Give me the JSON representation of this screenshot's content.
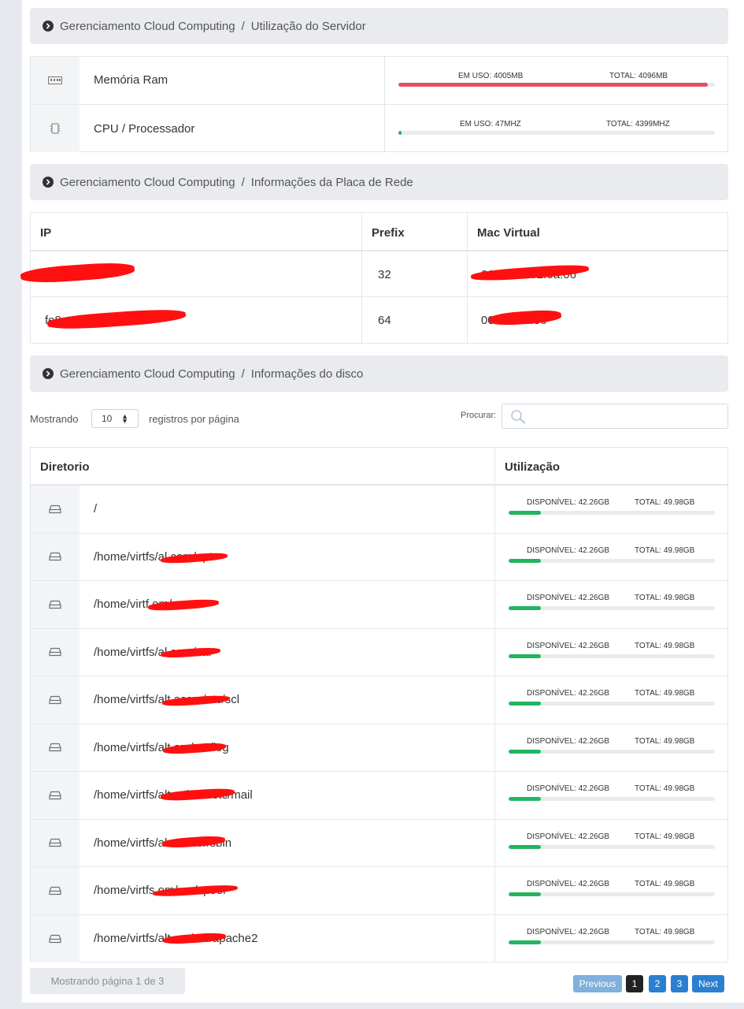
{
  "breadcrumbs": {
    "server": {
      "root": "Gerenciamento Cloud Computing",
      "separator": "/",
      "current": "Utilização do Servidor"
    },
    "network": {
      "root": "Gerenciamento Cloud Computing",
      "separator": "/",
      "current": "Informações da Placa de Rede"
    },
    "disk": {
      "root": "Gerenciamento Cloud Computing",
      "separator": "/",
      "current": "Informações do disco"
    }
  },
  "server_usage": [
    {
      "label": "Memória Ram",
      "icon": "ram-icon",
      "in_use": "EM USO: 4005MB",
      "total": "TOTAL: 4096MB",
      "fraction": 0.978,
      "color": "#e2525c"
    },
    {
      "label": "CPU / Processador",
      "icon": "cpu-icon",
      "in_use": "EM USO: 47MHZ",
      "total": "TOTAL: 4399MHZ",
      "fraction": 0.011,
      "color": "#22b55e"
    }
  ],
  "network": {
    "headers": {
      "ip": "IP",
      "prefix": "Prefix",
      "mac": "Mac Virtual"
    },
    "rows": [
      {
        "ip": "14",
        "prefix": "32",
        "mac": "00:50:56:02:0a:06"
      },
      {
        "ip": "fe8",
        "prefix": "64",
        "mac": "00:  02:8a:06"
      }
    ]
  },
  "disk_controls": {
    "showing_label": "Mostrando",
    "page_size": "10",
    "per_page_label": "registros por página",
    "search_label": "Procurar:",
    "search_value": ""
  },
  "disk_table": {
    "headers": {
      "dir": "Diretorio",
      "usage": "Utilização"
    },
    "available": "DISPONÍVEL: 42.26GB",
    "total": "TOTAL: 49.98GB",
    "fraction": 0.155,
    "color": "#22b55e",
    "rows": [
      {
        "path": "/"
      },
      {
        "path": "/home/virtfs/al         com/opt"
      },
      {
        "path": "/home/virtf            om/usr"
      },
      {
        "path": "/home/virtfs/al         com/var"
      },
      {
        "path": "/home/virtfs/alt        acom/etc/scl"
      },
      {
        "path": "/home/virtfs/alt        om/var/log"
      },
      {
        "path": "/home/virtfs/altesti     om/etc/mail"
      },
      {
        "path": "/home/virtfs/al         om/usr/sbin"
      },
      {
        "path": "/home/virtfs         om/var/spool"
      },
      {
        "path": "/home/virtfs/alt         om/etc/apache2"
      }
    ]
  },
  "pagination": {
    "info": "Mostrando página 1 de 3",
    "previous": "Previous",
    "pages": [
      "1",
      "2",
      "3"
    ],
    "active_page": "1",
    "next": "Next"
  }
}
